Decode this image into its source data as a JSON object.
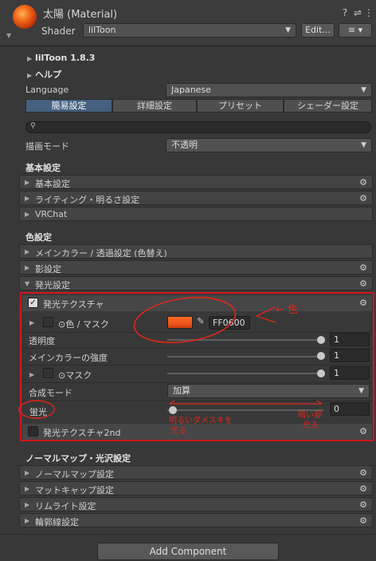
{
  "header": {
    "title": "太陽 (Material)",
    "shader_label": "Shader",
    "shader_value": "lilToon",
    "edit_label": "Edit...",
    "help_icon": "help-icon",
    "preset_icon": "preset-icon",
    "menu_icon": "more-icon"
  },
  "version": "lilToon 1.8.3",
  "help_label": "ヘルプ",
  "language": {
    "label": "Language",
    "value": "Japanese"
  },
  "tabs": [
    "簡易設定",
    "詳細設定",
    "プリセット",
    "シェーダー設定"
  ],
  "render_mode": {
    "label": "描画モード",
    "value": "不透明"
  },
  "basic": {
    "heading": "基本設定",
    "items": [
      "基本設定",
      "ライティング・明るさ設定",
      "VRChat"
    ]
  },
  "color": {
    "heading": "色設定",
    "items": [
      "メインカラー / 透過設定 (色替え)",
      "影設定",
      "発光設定"
    ]
  },
  "emission": {
    "header": "発光テクスチャ",
    "color_mask_label": "⊙色 / マスク",
    "color_hex": "FF0600",
    "color_swatch": "#f1561b",
    "transparency": {
      "label": "透明度",
      "value": "1",
      "fraction": 1
    },
    "main_color_strength": {
      "label": "メインカラーの強度",
      "value": "1",
      "fraction": 1
    },
    "mask": {
      "label": "⊙マスク",
      "value": "1",
      "fraction": 1
    },
    "blend_mode": {
      "label": "合成モード",
      "value": "加算"
    },
    "fluorescence": {
      "label": "蛍光",
      "value": "0",
      "fraction": 0
    },
    "second": "発光テクスチャ2nd"
  },
  "normal": {
    "heading": "ノーマルマップ・光沢設定",
    "items": [
      "ノーマルマップ設定",
      "マットキャップ設定",
      "リムライト設定",
      "輪郭線設定"
    ]
  },
  "add_component": "Add Component",
  "annotations": {
    "color_note": "← 色",
    "left_note_1": "明るいダメスキを",
    "left_note_2": "光る",
    "right_note_1": "暗い部",
    "right_note_2": "光る"
  },
  "colors": {
    "highlight": "#d4161c",
    "tab_active": "#46607f"
  }
}
